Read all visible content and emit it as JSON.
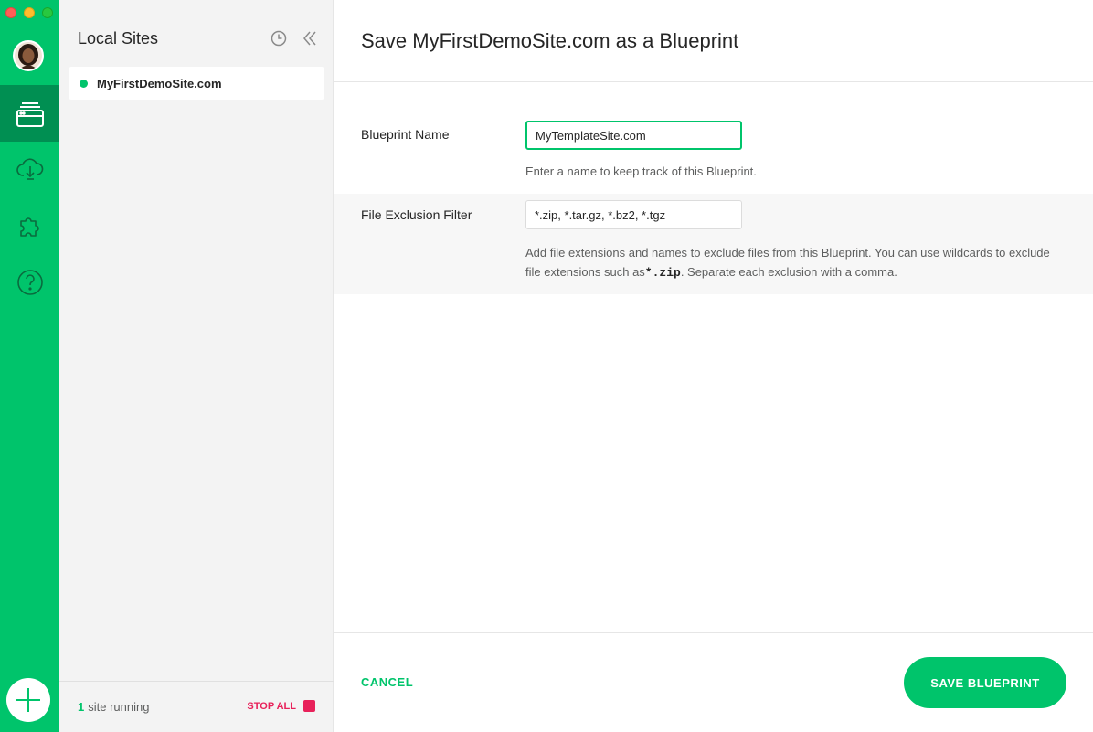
{
  "rail": {
    "items": [
      "avatar",
      "sites-icon",
      "cloud-icon",
      "addons-icon",
      "help-icon"
    ],
    "active": "sites-icon",
    "add_icon": "plus-icon",
    "accent": "#00c46b",
    "accent_dark": "#008f52"
  },
  "sidebar": {
    "title": "Local Sites",
    "icons": [
      "clock-icon",
      "collapse-icon"
    ],
    "sites": [
      {
        "name": "MyFirstDemoSite.com",
        "status": "running"
      }
    ],
    "footer": {
      "running_count": "1",
      "running_label": "site running",
      "stop_all_label": "STOP ALL"
    }
  },
  "main": {
    "title": "Save MyFirstDemoSite.com as a Blueprint",
    "fields": [
      {
        "label": "Blueprint Name",
        "value": "MyTemplateSite.com",
        "help": "Enter a name to keep track of this Blueprint."
      },
      {
        "label": "File Exclusion Filter",
        "value": "*.zip, *.tar.gz, *.bz2, *.tgz",
        "help_before": "Add file extensions and names to exclude files from this Blueprint. You can use wildcards to exclude file extensions such as",
        "help_code": "*.zip",
        "help_after": ". Separate each exclusion with a comma."
      }
    ],
    "cancel_label": "CANCEL",
    "save_label": "SAVE BLUEPRINT"
  },
  "colors": {
    "danger": "#e8215a",
    "panel_bg": "#f3f3f3"
  }
}
